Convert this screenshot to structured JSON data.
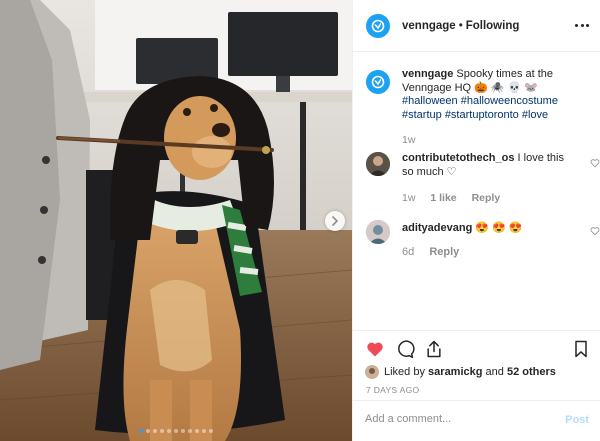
{
  "header": {
    "username": "venngage",
    "separator": "•",
    "follow_status": "Following",
    "more_icon": "more-horizontal-icon"
  },
  "photo": {
    "carousel_dot_count": 11,
    "active_dot_index": 0,
    "next_icon": "chevron-right-icon"
  },
  "caption": {
    "username": "venngage",
    "text": "Spooky times at the Venngage HQ 🎃 🕷️ 💀 🐭",
    "hashtags": [
      "#halloween",
      "#halloweencostume",
      "#startup",
      "#startuptoronto",
      "#love"
    ],
    "age": "1w"
  },
  "comments": [
    {
      "username": "contributetothech_os",
      "text": "I love this so much ♡",
      "age": "1w",
      "likes": "1 like",
      "reply_label": "Reply"
    },
    {
      "username": "adityadevang",
      "text": "😍 😍 😍",
      "age": "6d",
      "reply_label": "Reply"
    }
  ],
  "actions": {
    "like_icon": "heart-filled-icon",
    "comment_icon": "comment-icon",
    "share_icon": "share-icon",
    "save_icon": "bookmark-icon",
    "liked_prefix": "Liked by",
    "liked_user": "saramickg",
    "and_label": "and",
    "others": "52 others",
    "timestamp": "7 DAYS AGO"
  },
  "add_comment": {
    "placeholder": "Add a comment...",
    "post_label": "Post"
  },
  "colors": {
    "brand_blue": "#1da1f2",
    "like_red": "#ed4956",
    "hashtag": "#003569",
    "muted": "#8e8e8e",
    "post_disabled": "#b2dffc"
  }
}
